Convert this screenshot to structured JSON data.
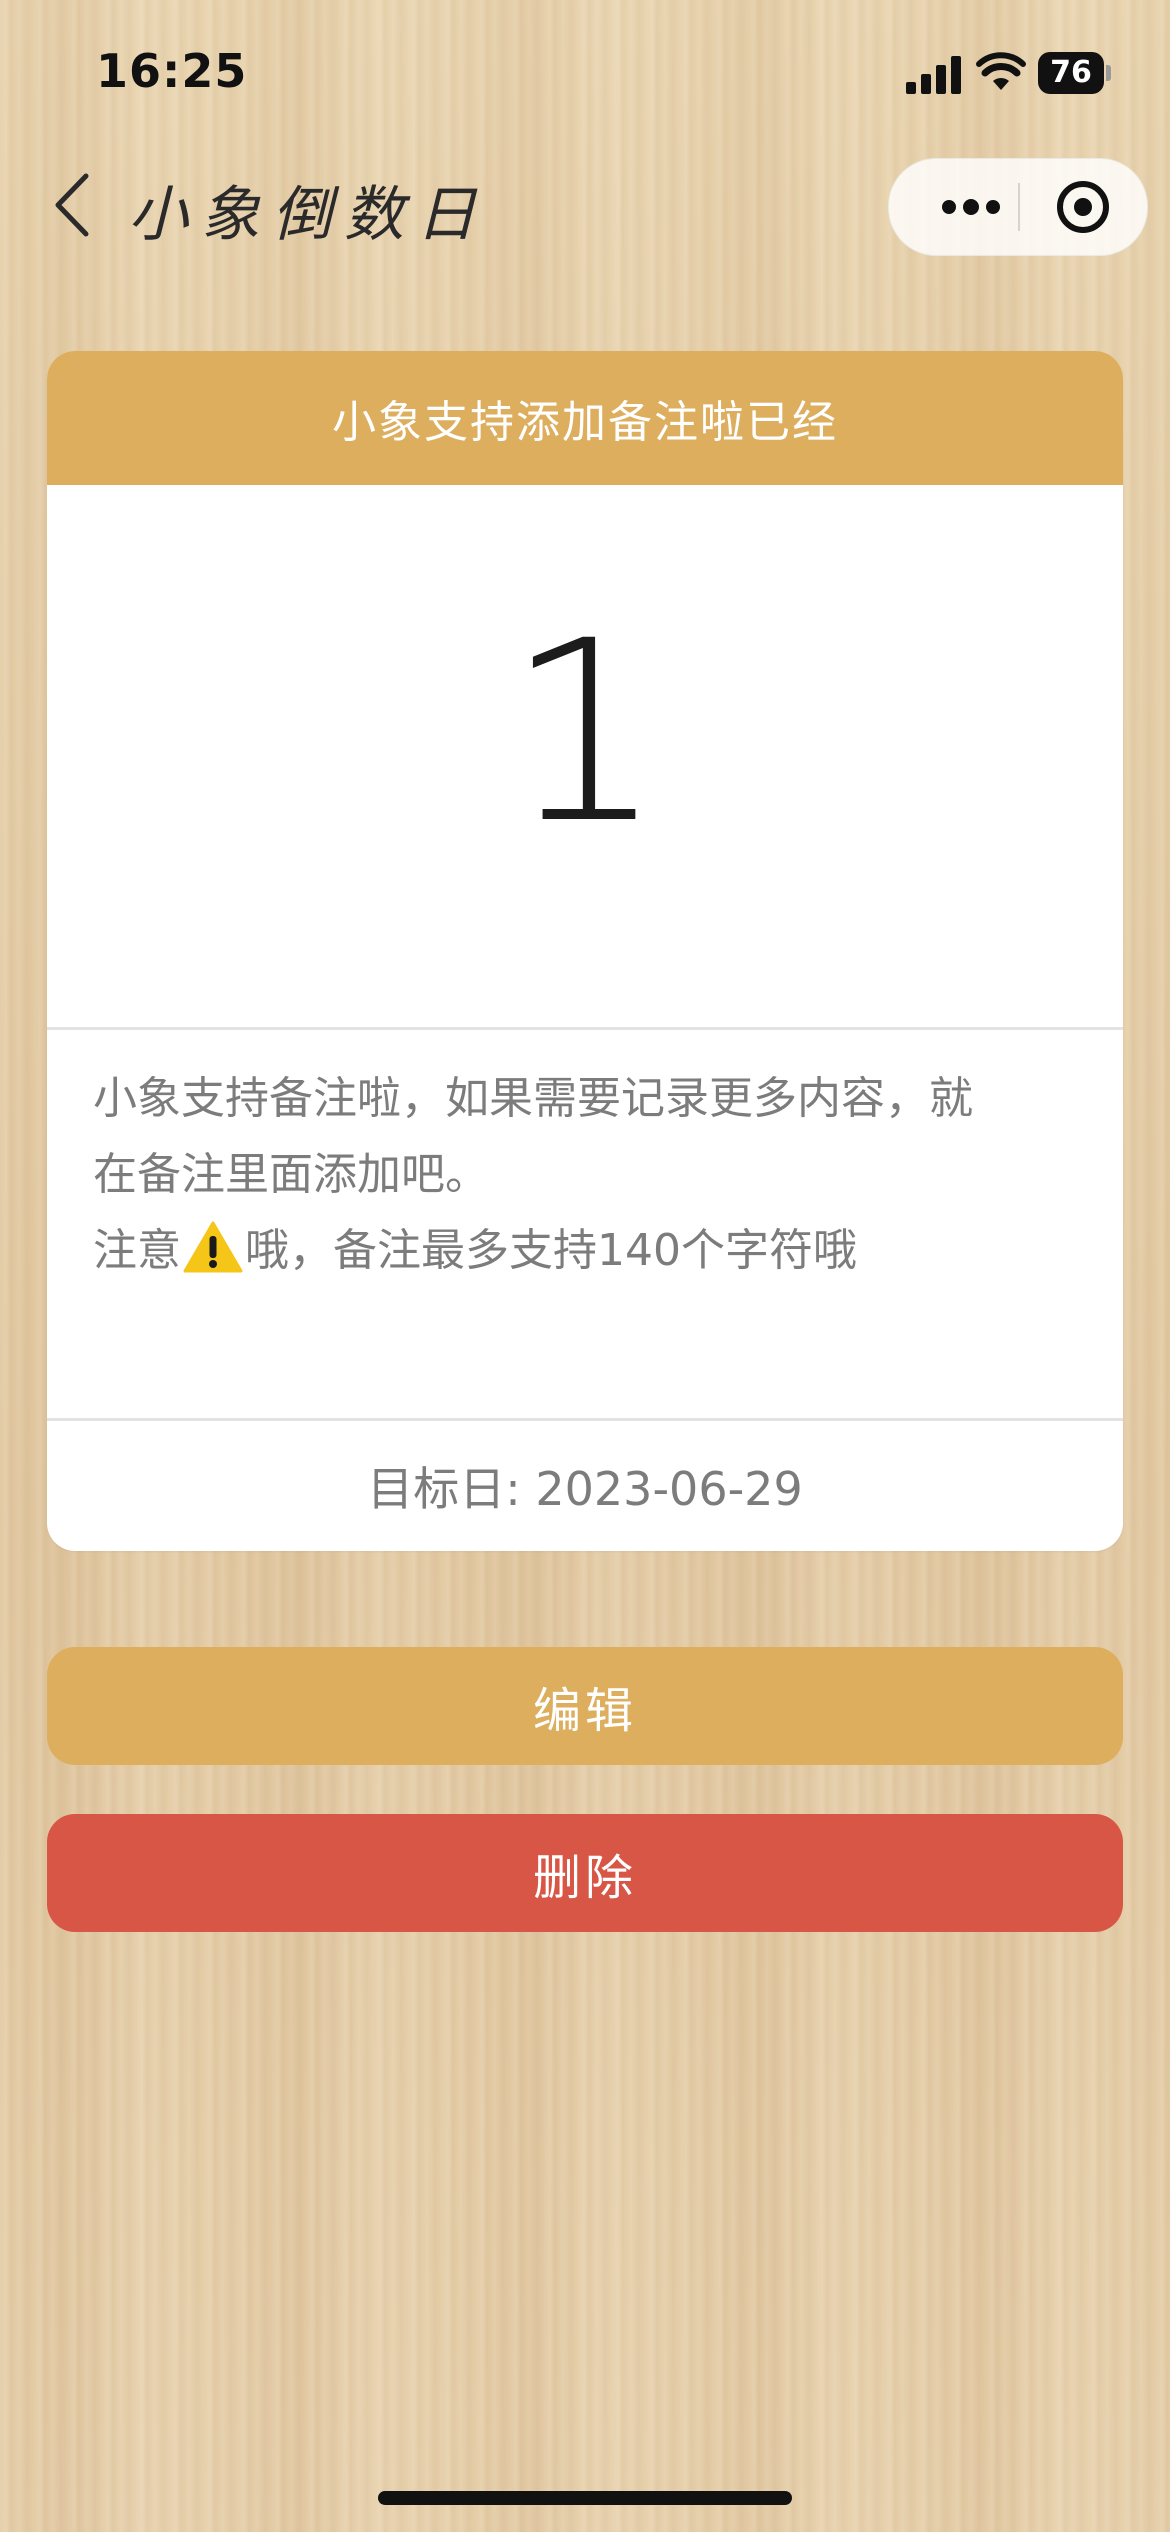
{
  "status_bar": {
    "time": "16:25",
    "battery": "76"
  },
  "nav": {
    "title": "小象倒数日"
  },
  "card": {
    "header": "小象支持添加备注啦已经",
    "count": "1",
    "note_line1": "小象支持备注啦，如果需要记录更多内容，就",
    "note_line2": "在备注里面添加吧。",
    "note_line3_a": "注意",
    "note_line3_b": "哦，备注最多支持140个字符哦",
    "target_date": "目标日: 2023-06-29"
  },
  "buttons": {
    "edit": "编辑",
    "delete": "删除"
  },
  "colors": {
    "accent": "#dcae5e",
    "danger": "#d85645"
  },
  "icons": [
    "back-chevron-icon",
    "more-icon",
    "close-target-icon",
    "warning-icon",
    "signal-icon",
    "wifi-icon",
    "battery-icon"
  ]
}
